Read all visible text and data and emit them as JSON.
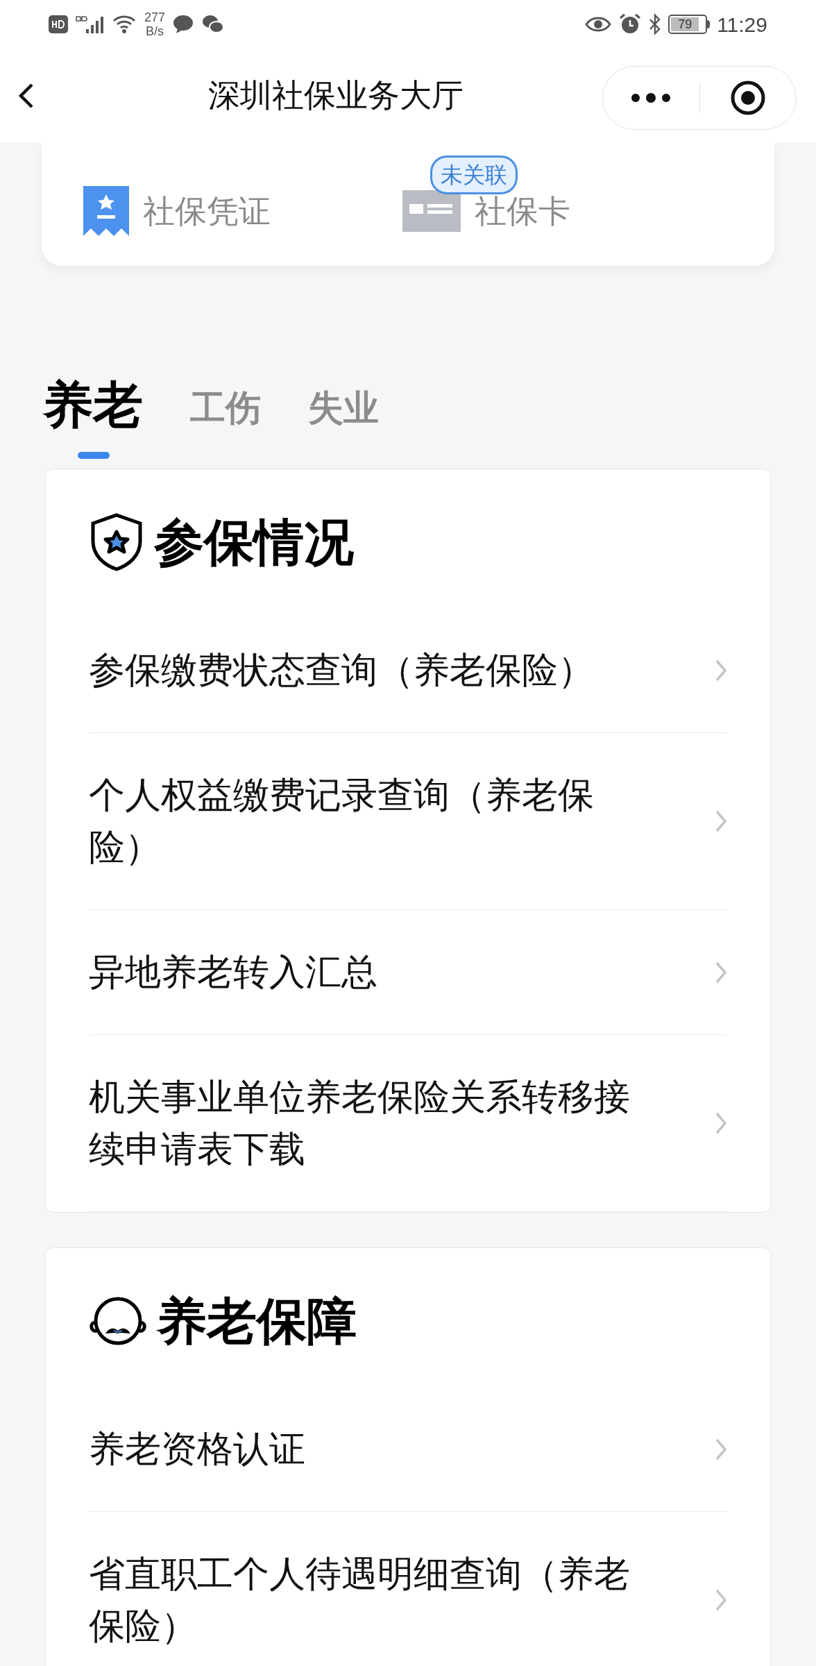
{
  "status_bar": {
    "network_speed": "277",
    "speed_unit": "B/s",
    "battery": "79",
    "time": "11:29"
  },
  "nav": {
    "title": "深圳社保业务大厅"
  },
  "quick_links": [
    {
      "kind": "certificate",
      "label": "社保凭证"
    },
    {
      "kind": "card",
      "label": "社保卡",
      "badge": "未关联"
    }
  ],
  "tabs": [
    {
      "label": "养老",
      "selected": true
    },
    {
      "label": "工伤",
      "selected": false
    },
    {
      "label": "失业",
      "selected": false
    }
  ],
  "sections": [
    {
      "kind": "shield",
      "title": "参保情况",
      "items": [
        "参保缴费状态查询（养老保险）",
        "个人权益缴费记录查询（养老保险）",
        "异地养老转入汇总",
        "机关事业单位养老保险关系转移接续申请表下载"
      ]
    },
    {
      "kind": "elder",
      "title": "养老保障",
      "items": [
        "养老资格认证",
        "省直职工个人待遇明细查询（养老保险）"
      ]
    }
  ]
}
